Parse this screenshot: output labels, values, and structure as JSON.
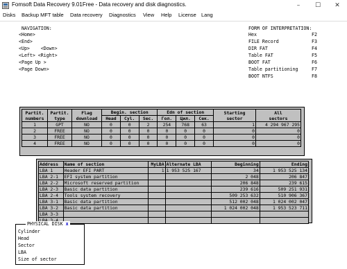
{
  "window": {
    "title": "Fomsoft Data Recovery 9.01Free - Data recovery and disk diagnostics.",
    "minimize": "–",
    "maximize": "☐",
    "close": "✕"
  },
  "menu": [
    "Disks",
    "Backup MFT table",
    "Data recovery",
    "Diagnostics",
    "View",
    "Help",
    "License",
    "Lang"
  ],
  "navigation": {
    "title": "NAVIGATION:",
    "lines": [
      "<Home>",
      "<End>",
      "<Up>    <Down>",
      "<Left> <Right>",
      "<Page Up >",
      "<Page Down>"
    ]
  },
  "interpretation": {
    "title": "FORM OF INTERPRETATION:",
    "items": [
      {
        "label": "Hex",
        "key": "F2"
      },
      {
        "label": "FILE Record",
        "key": "F3"
      },
      {
        "label": "DIR FAT",
        "key": "F4"
      },
      {
        "label": "Table FAT",
        "key": "F5"
      },
      {
        "label": "BOOT FAT",
        "key": "F6"
      },
      {
        "label": "Table partitioning",
        "key": "F7"
      },
      {
        "label": "BOOT NTFS",
        "key": "F8"
      }
    ]
  },
  "partition_table": {
    "group_headers": {
      "partit_numbers": [
        "Partit.",
        "numbers"
      ],
      "partit_type": [
        "Partit.",
        "type"
      ],
      "flag": [
        "Flag",
        "download"
      ],
      "begin": "Begin. section",
      "end": "Edn of section",
      "starting": [
        "Starting",
        "sector"
      ],
      "all": [
        "All",
        "sectors"
      ]
    },
    "sub_headers": [
      "Head",
      "Cyl.",
      "Sec.",
      "Гол.",
      "Цил.",
      "Сек."
    ],
    "rows": [
      [
        "1",
        "GPT",
        "NO",
        "0",
        "0",
        "2",
        "254",
        "768",
        "63",
        "1",
        "4 294 967 295"
      ],
      [
        "2",
        "FREE",
        "NO",
        "0",
        "0",
        "0",
        "0",
        "0",
        "0",
        "0",
        "0"
      ],
      [
        "3",
        "FREE",
        "NO",
        "0",
        "0",
        "0",
        "0",
        "0",
        "0",
        "0",
        "0"
      ],
      [
        "4",
        "FREE",
        "NO",
        "0",
        "0",
        "0",
        "0",
        "0",
        "0",
        "0",
        "0"
      ]
    ]
  },
  "gpt_table": {
    "headers": [
      "Address",
      "Name of section",
      "MyLBA",
      "Alternate LBA",
      "Beginning",
      "Ending"
    ],
    "rows": [
      [
        "LBA 1",
        "Header EFI PART",
        "1",
        "1 953 525 167",
        "34",
        "1 953 525 134"
      ],
      [
        "LBA 2-1",
        "EFI system partition",
        "",
        "",
        "2 048",
        "206 847"
      ],
      [
        "LBA 2-2",
        "Microsoft reserved partition",
        "",
        "",
        "206 848",
        "239 615"
      ],
      [
        "LBA 2-3",
        "Basic data partition",
        "",
        "",
        "239 616",
        "509 251 931"
      ],
      [
        "LBA 2-4",
        "Tools system recovery",
        "",
        "",
        "509 253 632",
        "510 906 367"
      ],
      [
        "LBA 3-1",
        "Basic data partition",
        "",
        "",
        "512 002 048",
        "1 024 002 047"
      ],
      [
        "LBA 3-2",
        "Basic data partition",
        "",
        "",
        "1 024 002 048",
        "1 953 523 711"
      ],
      [
        "LBA 3-3",
        "",
        "",
        "",
        "",
        ""
      ],
      [
        "LBA 3-4",
        "",
        "",
        "",
        "",
        ""
      ]
    ]
  },
  "physical_disk": {
    "title": "PHYSICAL DISK",
    "close": "x",
    "lines": [
      "Cylinder",
      "Head",
      "Sector",
      "LBA",
      "Size of sector"
    ]
  },
  "colors": {
    "panel_bg": "#c0c0c0",
    "close_x": "#0000cc"
  }
}
